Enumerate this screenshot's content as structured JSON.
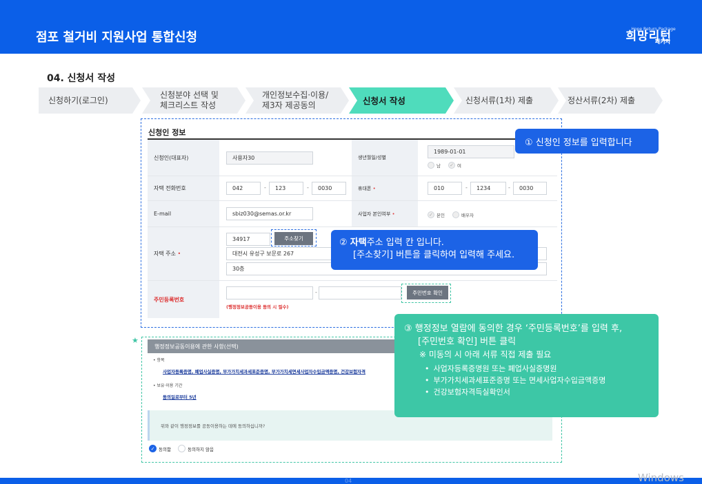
{
  "header": {
    "title": "점포 철거비 지원사업 통합신청",
    "logo_main": "희망리턴",
    "logo_sub": "Hope Return Package",
    "logo_small": "패키지"
  },
  "section_title": "04. 신청서 작성",
  "steps": [
    {
      "label": "신청하기(로그인)",
      "active": false
    },
    {
      "label_line1": "신청분야 선택 및",
      "label_line2": "체크리스트 작성",
      "active": false
    },
    {
      "label_line1": "개인정보수집·이용/",
      "label_line2": "제3자 제공동의",
      "active": false
    },
    {
      "label": "신청서 작성",
      "active": true
    },
    {
      "label": "신청서류(1차) 제출",
      "active": false
    },
    {
      "label": "정산서류(2차) 제출",
      "active": false
    }
  ],
  "form": {
    "title": "신청인 정보",
    "applicant_label": "신청인(대표자)",
    "applicant_value": "사용자30",
    "birth_label": "생년월일/성별",
    "birth_value": "1989-01-01",
    "gender_male": "남",
    "gender_female": "여",
    "home_phone_label": "자택 전화번호",
    "home_phone": [
      "042",
      "123",
      "0030"
    ],
    "mobile_label": "휴대폰",
    "mobile": [
      "010",
      "1234",
      "0030"
    ],
    "email_label": "E-mail",
    "email_value": "sbiz030@semas.or.kr",
    "self_label": "사업자 본인여부",
    "self_option1": "본인",
    "self_option2": "배우자",
    "address_label": "자택 주소",
    "zipcode": "34917",
    "address_search_button": "주소찾기",
    "address1": "대전시 유성구 보문로 267",
    "address2": "30층",
    "rrn_label": "주민등록번호",
    "rrn_note": "(행정정보공동이용 동의 시 필수)",
    "rrn_confirm_button": "주민번호 확인",
    "required_mark": "•"
  },
  "callouts": {
    "c1": "① 신청인 정보를 입력합니다",
    "c2_prefix": "② ",
    "c2_bold": "자택",
    "c2_rest": "주소 입력 칸 입니다.",
    "c2_line2": "[주소찾기] 버튼을 클릭하여 입력해 주세요.",
    "c3_line1": "③ 행정정보 열람에 동의한 경우 ‘주민등록번호’를 입력 후,",
    "c3_line2": "[주민번호 확인] 버튼 클릭",
    "c3_note": "※ 미동의 시 아래 서류 직접 제출 필요",
    "c3_items": [
      "사업자등록증명원 또는 폐업사실증명원",
      "부가가치세과세표준증명 또는 면세사업자수입금액증명",
      "건강보험자격득실확인서"
    ]
  },
  "consent": {
    "title": "행정정보공동이용에 관한 사항(선택)",
    "items_label": "• 항목",
    "items_value": "사업자등록증명, 폐업사실증명, 부가가치세과세표준증명, 부가가치세면세사업자수입금액증명, 건강보험자격",
    "period_label": "• 보유·이용 기간",
    "period_value": "동의일로부터 5년",
    "question": "위와 같이 행정정보를 공동이용하는 데에 동의하십니까?",
    "agree": "동의함",
    "disagree": "동의하지 않음"
  },
  "footer": {
    "page_number": "04",
    "watermark": "Windows"
  },
  "colors": {
    "brand_blue": "#0b5fe8",
    "callout_blue": "#1c63e6",
    "callout_green": "#3dc7a6",
    "active_step": "#4fdcbc"
  }
}
